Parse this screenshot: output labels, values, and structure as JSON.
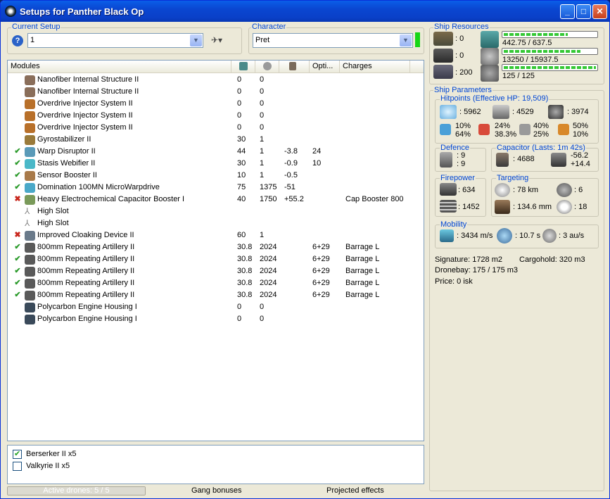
{
  "window": {
    "title": "Setups for Panther Black Op",
    "min": "_",
    "max": "□",
    "close": "✕"
  },
  "current_setup": {
    "label": "Current Setup",
    "value": "1",
    "help": "?"
  },
  "character": {
    "label": "Character",
    "value": "Pret"
  },
  "modules": {
    "headers": [
      "Modules",
      "",
      "",
      "",
      "Opti...",
      "Charges"
    ],
    "rows": [
      {
        "mark": "",
        "name": "Nanofiber Internal Structure II",
        "c1": "0",
        "c2": "0",
        "c3": "",
        "opt": "",
        "charge": "",
        "color": "#8a6e5a"
      },
      {
        "mark": "",
        "name": "Nanofiber Internal Structure II",
        "c1": "0",
        "c2": "0",
        "c3": "",
        "opt": "",
        "charge": "",
        "color": "#8a6e5a"
      },
      {
        "mark": "",
        "name": "Overdrive Injector System II",
        "c1": "0",
        "c2": "0",
        "c3": "",
        "opt": "",
        "charge": "",
        "color": "#b8702a"
      },
      {
        "mark": "",
        "name": "Overdrive Injector System II",
        "c1": "0",
        "c2": "0",
        "c3": "",
        "opt": "",
        "charge": "",
        "color": "#b8702a"
      },
      {
        "mark": "",
        "name": "Overdrive Injector System II",
        "c1": "0",
        "c2": "0",
        "c3": "",
        "opt": "",
        "charge": "",
        "color": "#b8702a"
      },
      {
        "mark": "",
        "name": "Gyrostabilizer II",
        "c1": "30",
        "c2": "1",
        "c3": "",
        "opt": "",
        "charge": "",
        "color": "#9a7a3a"
      },
      {
        "mark": "ok",
        "name": "Warp Disruptor II",
        "c1": "44",
        "c2": "1",
        "c3": "-3.8",
        "opt": "24",
        "charge": "",
        "color": "#5a9ab8"
      },
      {
        "mark": "ok",
        "name": "Stasis Webifier II",
        "c1": "30",
        "c2": "1",
        "c3": "-0.9",
        "opt": "10",
        "charge": "",
        "color": "#4ab8c8"
      },
      {
        "mark": "ok",
        "name": "Sensor Booster II",
        "c1": "10",
        "c2": "1",
        "c3": "-0.5",
        "opt": "",
        "charge": "",
        "color": "#a87a4a"
      },
      {
        "mark": "ok",
        "name": "Domination 100MN MicroWarpdrive",
        "c1": "75",
        "c2": "1375",
        "c3": "-51",
        "opt": "",
        "charge": "",
        "color": "#4aa8c8"
      },
      {
        "mark": "bad",
        "name": "Heavy Electrochemical Capacitor Booster I",
        "c1": "40",
        "c2": "1750",
        "c3": "+55.2",
        "opt": "",
        "charge": "Cap Booster 800",
        "color": "#7a9a5a"
      },
      {
        "mark": "",
        "name": "High Slot",
        "c1": "",
        "c2": "",
        "c3": "",
        "opt": "",
        "charge": "",
        "color": "#ffffff"
      },
      {
        "mark": "",
        "name": "High Slot",
        "c1": "",
        "c2": "",
        "c3": "",
        "opt": "",
        "charge": "",
        "color": "#ffffff"
      },
      {
        "mark": "bad",
        "name": "Improved Cloaking Device II",
        "c1": "60",
        "c2": "1",
        "c3": "",
        "opt": "",
        "charge": "",
        "color": "#6a7a8a"
      },
      {
        "mark": "ok",
        "name": "800mm Repeating Artillery II",
        "c1": "30.8",
        "c2": "2024",
        "c3": "",
        "opt": "6+29",
        "charge": "Barrage L",
        "color": "#5a5a5a"
      },
      {
        "mark": "ok",
        "name": "800mm Repeating Artillery II",
        "c1": "30.8",
        "c2": "2024",
        "c3": "",
        "opt": "6+29",
        "charge": "Barrage L",
        "color": "#5a5a5a"
      },
      {
        "mark": "ok",
        "name": "800mm Repeating Artillery II",
        "c1": "30.8",
        "c2": "2024",
        "c3": "",
        "opt": "6+29",
        "charge": "Barrage L",
        "color": "#5a5a5a"
      },
      {
        "mark": "ok",
        "name": "800mm Repeating Artillery II",
        "c1": "30.8",
        "c2": "2024",
        "c3": "",
        "opt": "6+29",
        "charge": "Barrage L",
        "color": "#5a5a5a"
      },
      {
        "mark": "ok",
        "name": "800mm Repeating Artillery II",
        "c1": "30.8",
        "c2": "2024",
        "c3": "",
        "opt": "6+29",
        "charge": "Barrage L",
        "color": "#5a5a5a"
      },
      {
        "mark": "",
        "name": "Polycarbon Engine Housing I",
        "c1": "0",
        "c2": "0",
        "c3": "",
        "opt": "",
        "charge": "",
        "color": "#3a4a5a"
      },
      {
        "mark": "",
        "name": "Polycarbon Engine Housing I",
        "c1": "0",
        "c2": "0",
        "c3": "",
        "opt": "",
        "charge": "",
        "color": "#3a4a5a"
      }
    ]
  },
  "drones": [
    {
      "name": "Berserker II x5",
      "checked": true
    },
    {
      "name": "Valkyrie II x5",
      "checked": false
    }
  ],
  "footer": {
    "active_drones": "Active drones: 5 / 5",
    "active_drones_progress": 1,
    "gang": "Gang bonuses",
    "projected": "Projected effects"
  },
  "resources": {
    "label": "Ship Resources",
    "hardpoints": [
      ": 0",
      ": 0",
      ": 200"
    ],
    "cpu": {
      "text": "442.75 / 637.5",
      "fill": 0.695
    },
    "pg": {
      "text": "13250 / 15937.5",
      "fill": 0.831
    },
    "calib": {
      "text": "125 / 125",
      "fill": 1.0
    }
  },
  "params": {
    "label": "Ship Parameters",
    "hp": {
      "label": "Hitpoints (Effective HP: 19,509)",
      "shield": ": 5962",
      "armor": ": 4529",
      "structure": ": 3974",
      "res": [
        [
          "10%",
          "64%"
        ],
        [
          "24%",
          "38.3%"
        ],
        [
          "40%",
          "25%"
        ],
        [
          "50%",
          "10%"
        ]
      ]
    },
    "defence": {
      "label": "Defence",
      "v1": ": 9",
      "v2": ": 9"
    },
    "capacitor": {
      "label": "Capacitor (Lasts: 1m 42s)",
      "cap": ": 4688",
      "v1": "-56.2",
      "v2": "+14.4"
    },
    "firepower": {
      "label": "Firepower",
      "v1": ": 634",
      "v2": ": 1452"
    },
    "targeting": {
      "label": "Targeting",
      "range": ": 78 km",
      "targets": ": 6",
      "scan": ": 134.6 mm",
      "sig": ": 18"
    },
    "mobility": {
      "label": "Mobility",
      "speed": ": 3434 m/s",
      "align": ": 10.7 s",
      "warp": ": 3 au/s"
    },
    "signature": "Signature: 1728 m2",
    "cargo": "Cargohold: 320 m3",
    "dronebay": "Dronebay: 175 / 175 m3",
    "price": "Price: 0 isk"
  }
}
